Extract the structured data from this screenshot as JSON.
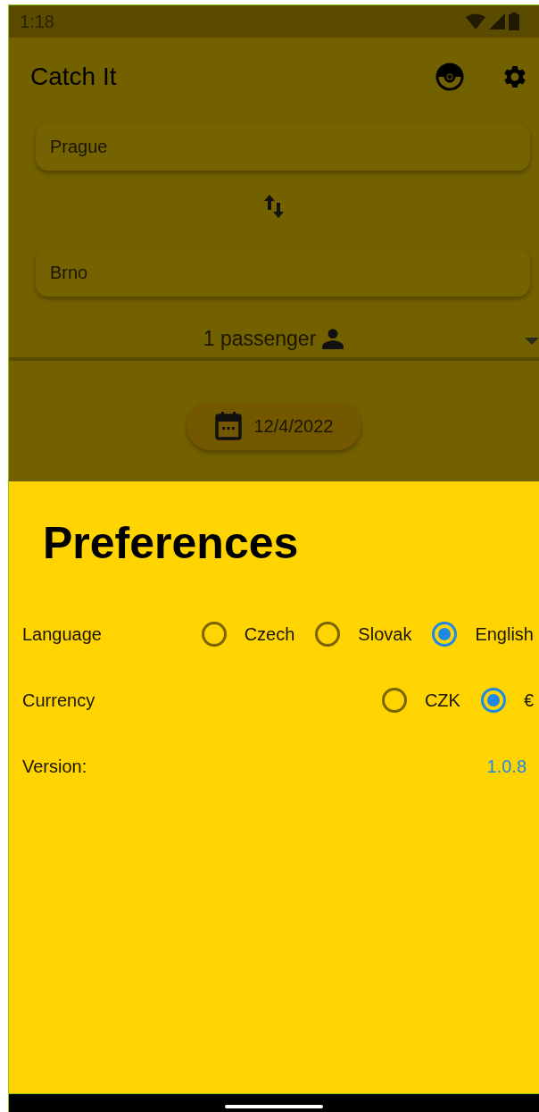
{
  "status_bar": {
    "time": "1:18"
  },
  "app_bar": {
    "title": "Catch It"
  },
  "search": {
    "from": "Prague",
    "to": "Brno",
    "passengers": "1 passenger",
    "date": "12/4/2022"
  },
  "preferences": {
    "title": "Preferences",
    "rows": [
      {
        "label": "Language",
        "options": [
          {
            "label": "Czech",
            "selected": false
          },
          {
            "label": "Slovak",
            "selected": false
          },
          {
            "label": "English",
            "selected": true
          }
        ]
      },
      {
        "label": "Currency",
        "options": [
          {
            "label": "CZK",
            "selected": false
          },
          {
            "label": "€",
            "selected": true
          }
        ]
      }
    ],
    "version": {
      "label": "Version:",
      "value": "1.0.8"
    }
  }
}
